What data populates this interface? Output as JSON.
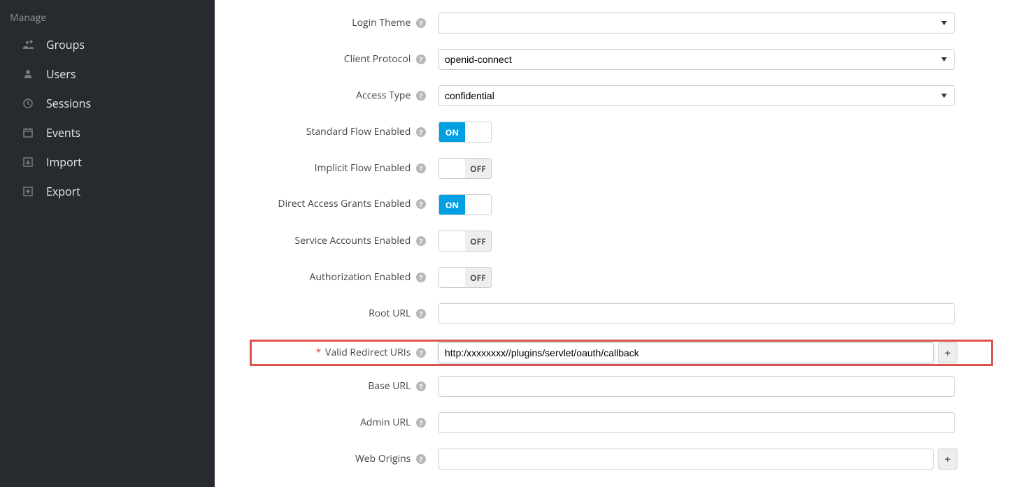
{
  "sidebar": {
    "section": "Manage",
    "items": [
      {
        "label": "Groups",
        "icon": "groups"
      },
      {
        "label": "Users",
        "icon": "user"
      },
      {
        "label": "Sessions",
        "icon": "clock"
      },
      {
        "label": "Events",
        "icon": "calendar"
      },
      {
        "label": "Import",
        "icon": "import"
      },
      {
        "label": "Export",
        "icon": "export"
      }
    ]
  },
  "form": {
    "login_theme": {
      "label": "Login Theme",
      "value": ""
    },
    "client_protocol": {
      "label": "Client Protocol",
      "value": "openid-connect"
    },
    "access_type": {
      "label": "Access Type",
      "value": "confidential"
    },
    "standard_flow": {
      "label": "Standard Flow Enabled",
      "value": true,
      "on": "ON"
    },
    "implicit_flow": {
      "label": "Implicit Flow Enabled",
      "value": false,
      "off": "OFF"
    },
    "direct_access": {
      "label": "Direct Access Grants Enabled",
      "value": true,
      "on": "ON"
    },
    "service_accounts": {
      "label": "Service Accounts Enabled",
      "value": false,
      "off": "OFF"
    },
    "authorization": {
      "label": "Authorization Enabled",
      "value": false,
      "off": "OFF"
    },
    "root_url": {
      "label": "Root URL",
      "value": ""
    },
    "valid_redirect": {
      "label": "Valid Redirect URIs",
      "value": "http:/xxxxxxxx//plugins/servlet/oauth/callback"
    },
    "base_url": {
      "label": "Base URL",
      "value": ""
    },
    "admin_url": {
      "label": "Admin URL",
      "value": ""
    },
    "web_origins": {
      "label": "Web Origins",
      "value": ""
    }
  },
  "icons": {
    "help": "?",
    "plus": "+"
  }
}
